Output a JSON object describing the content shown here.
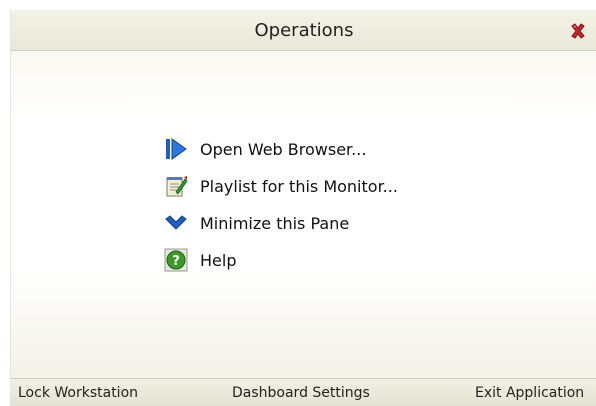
{
  "pane": {
    "title": "Operations",
    "close_icon": "close-x-icon"
  },
  "menu": {
    "items": [
      {
        "label": "Open Web Browser...",
        "icon": "browser-arrow-icon"
      },
      {
        "label": "Playlist for this Monitor...",
        "icon": "playlist-notepad-icon"
      },
      {
        "label": "Minimize this Pane",
        "icon": "chevron-down-icon"
      },
      {
        "label": "Help",
        "icon": "help-icon"
      }
    ]
  },
  "footer": {
    "lock_label": "Lock Workstation",
    "dashboard_label": "Dashboard Settings",
    "exit_label": "Exit Application"
  },
  "colors": {
    "accent_blue": "#1f5fbf",
    "help_green": "#3a9a2a",
    "close_red": "#c42a2a"
  }
}
